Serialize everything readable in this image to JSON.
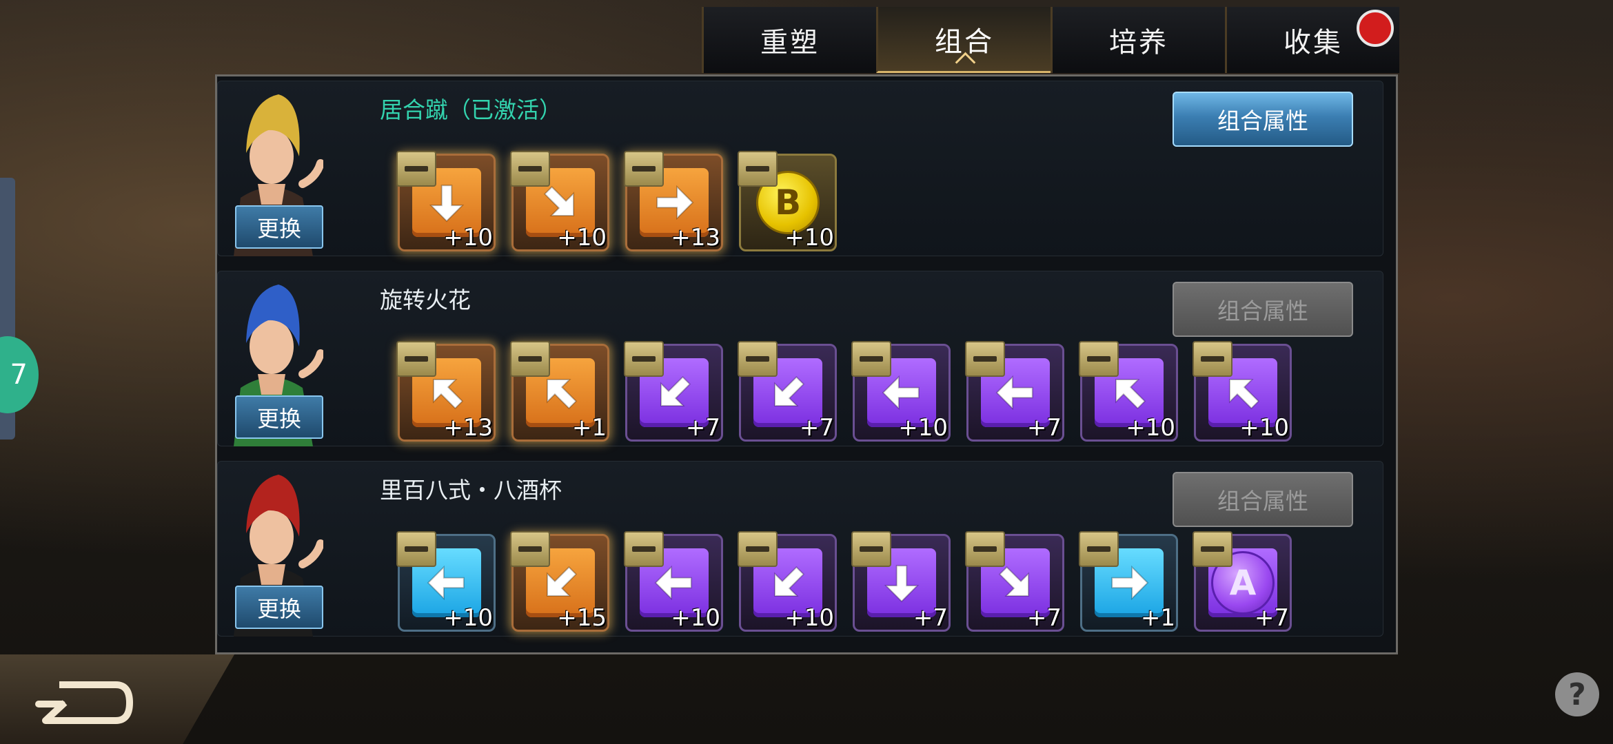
{
  "tabs": [
    {
      "label": "重塑",
      "active": false
    },
    {
      "label": "组合",
      "active": true
    },
    {
      "label": "培养",
      "active": false
    },
    {
      "label": "收集",
      "active": false,
      "alert": true
    }
  ],
  "side_tab_label": "7",
  "combos": [
    {
      "title": "居合蹴（已激活）",
      "activated": true,
      "swap_label": "更换",
      "attr_label": "组合属性",
      "attr_enabled": true,
      "portrait": "blonde-fighter-portrait",
      "moves": [
        {
          "type": "arrow",
          "color": "orange",
          "dir": "down",
          "level": "+10"
        },
        {
          "type": "arrow",
          "color": "orange",
          "dir": "down-right",
          "level": "+10"
        },
        {
          "type": "arrow",
          "color": "orange",
          "dir": "right",
          "level": "+13"
        },
        {
          "type": "coin",
          "color": "gold",
          "letter": "B",
          "level": "+10"
        }
      ]
    },
    {
      "title": "旋转火花",
      "activated": false,
      "swap_label": "更换",
      "attr_label": "组合属性",
      "attr_enabled": false,
      "portrait": "blue-hair-fighter-portrait",
      "moves": [
        {
          "type": "arrow",
          "color": "orange",
          "dir": "up-left",
          "level": "+13"
        },
        {
          "type": "arrow",
          "color": "orange",
          "dir": "up-left",
          "level": "+1"
        },
        {
          "type": "arrow",
          "color": "purple",
          "dir": "down-left",
          "level": "+7"
        },
        {
          "type": "arrow",
          "color": "purple",
          "dir": "down-left",
          "level": "+7"
        },
        {
          "type": "arrow",
          "color": "purple",
          "dir": "left",
          "level": "+10"
        },
        {
          "type": "arrow",
          "color": "purple",
          "dir": "left",
          "level": "+7"
        },
        {
          "type": "arrow",
          "color": "purple",
          "dir": "up-left",
          "level": "+10"
        },
        {
          "type": "arrow",
          "color": "purple",
          "dir": "up-left",
          "level": "+10"
        }
      ]
    },
    {
      "title": "里百八式・八酒杯",
      "activated": false,
      "swap_label": "更换",
      "attr_label": "组合属性",
      "attr_enabled": false,
      "portrait": "red-hair-fighter-portrait",
      "moves": [
        {
          "type": "arrow",
          "color": "blue",
          "dir": "left",
          "level": "+10"
        },
        {
          "type": "arrow",
          "color": "orange",
          "dir": "down-left",
          "level": "+15"
        },
        {
          "type": "arrow",
          "color": "purple",
          "dir": "left",
          "level": "+10"
        },
        {
          "type": "arrow",
          "color": "purple",
          "dir": "down-left",
          "level": "+10"
        },
        {
          "type": "arrow",
          "color": "purple",
          "dir": "down",
          "level": "+7"
        },
        {
          "type": "arrow",
          "color": "purple",
          "dir": "down-right",
          "level": "+7"
        },
        {
          "type": "arrow",
          "color": "blue",
          "dir": "right",
          "level": "+1"
        },
        {
          "type": "coin",
          "color": "purple",
          "letter": "A",
          "level": "+7"
        }
      ]
    }
  ],
  "help_label": "?",
  "colors": {
    "accent": "#d8b46a",
    "activated": "#33d3ae",
    "alert": "#d21d1d"
  }
}
